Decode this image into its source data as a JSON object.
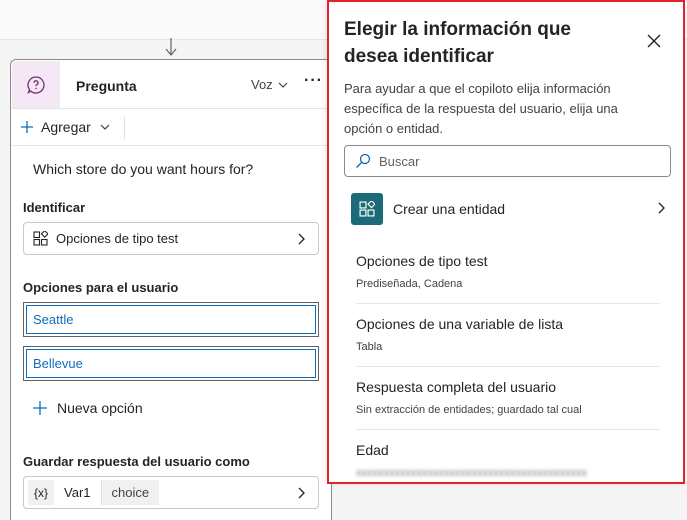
{
  "node": {
    "title": "Pregunta",
    "mode": "Voz",
    "more": "···",
    "add_label": "Agregar",
    "question": "Which store do you want hours for?",
    "identify_label": "Identificar",
    "identify_value": "Opciones de tipo test",
    "options_label": "Opciones para el usuario",
    "options": [
      "Seattle",
      "Bellevue"
    ],
    "new_option_label": "Nueva opción",
    "save_label": "Guardar respuesta del usuario como",
    "variable": {
      "prefix": "{x}",
      "name": "Var1",
      "type": "choice"
    }
  },
  "panel": {
    "title": "Elegir la información que desea identificar",
    "description": "Para ayudar a que el copiloto elija información específica de la respuesta del usuario, elija una opción o entidad.",
    "search_placeholder": "Buscar",
    "create_entity_label": "Crear una entidad",
    "entities": [
      {
        "name": "Opciones de tipo test",
        "meta": "Prediseñada, Cadena"
      },
      {
        "name": "Opciones de una variable de lista",
        "meta": "Tabla"
      },
      {
        "name": "Respuesta completa del usuario",
        "meta": "Sin extracción de entidades; guardado tal cual"
      },
      {
        "name": "Edad",
        "meta": ""
      }
    ]
  },
  "colors": {
    "accent": "#0f6cbd",
    "highlight_border": "#e3222d",
    "entity_icon_bg": "#1b6b79",
    "node_icon_bg": "#f3e8f3"
  },
  "icons": [
    "question-icon",
    "chevron-down-icon",
    "more-icon",
    "plus-icon",
    "option-set-icon",
    "chevron-right-icon",
    "close-icon",
    "search-icon",
    "connector-arrow-icon"
  ]
}
